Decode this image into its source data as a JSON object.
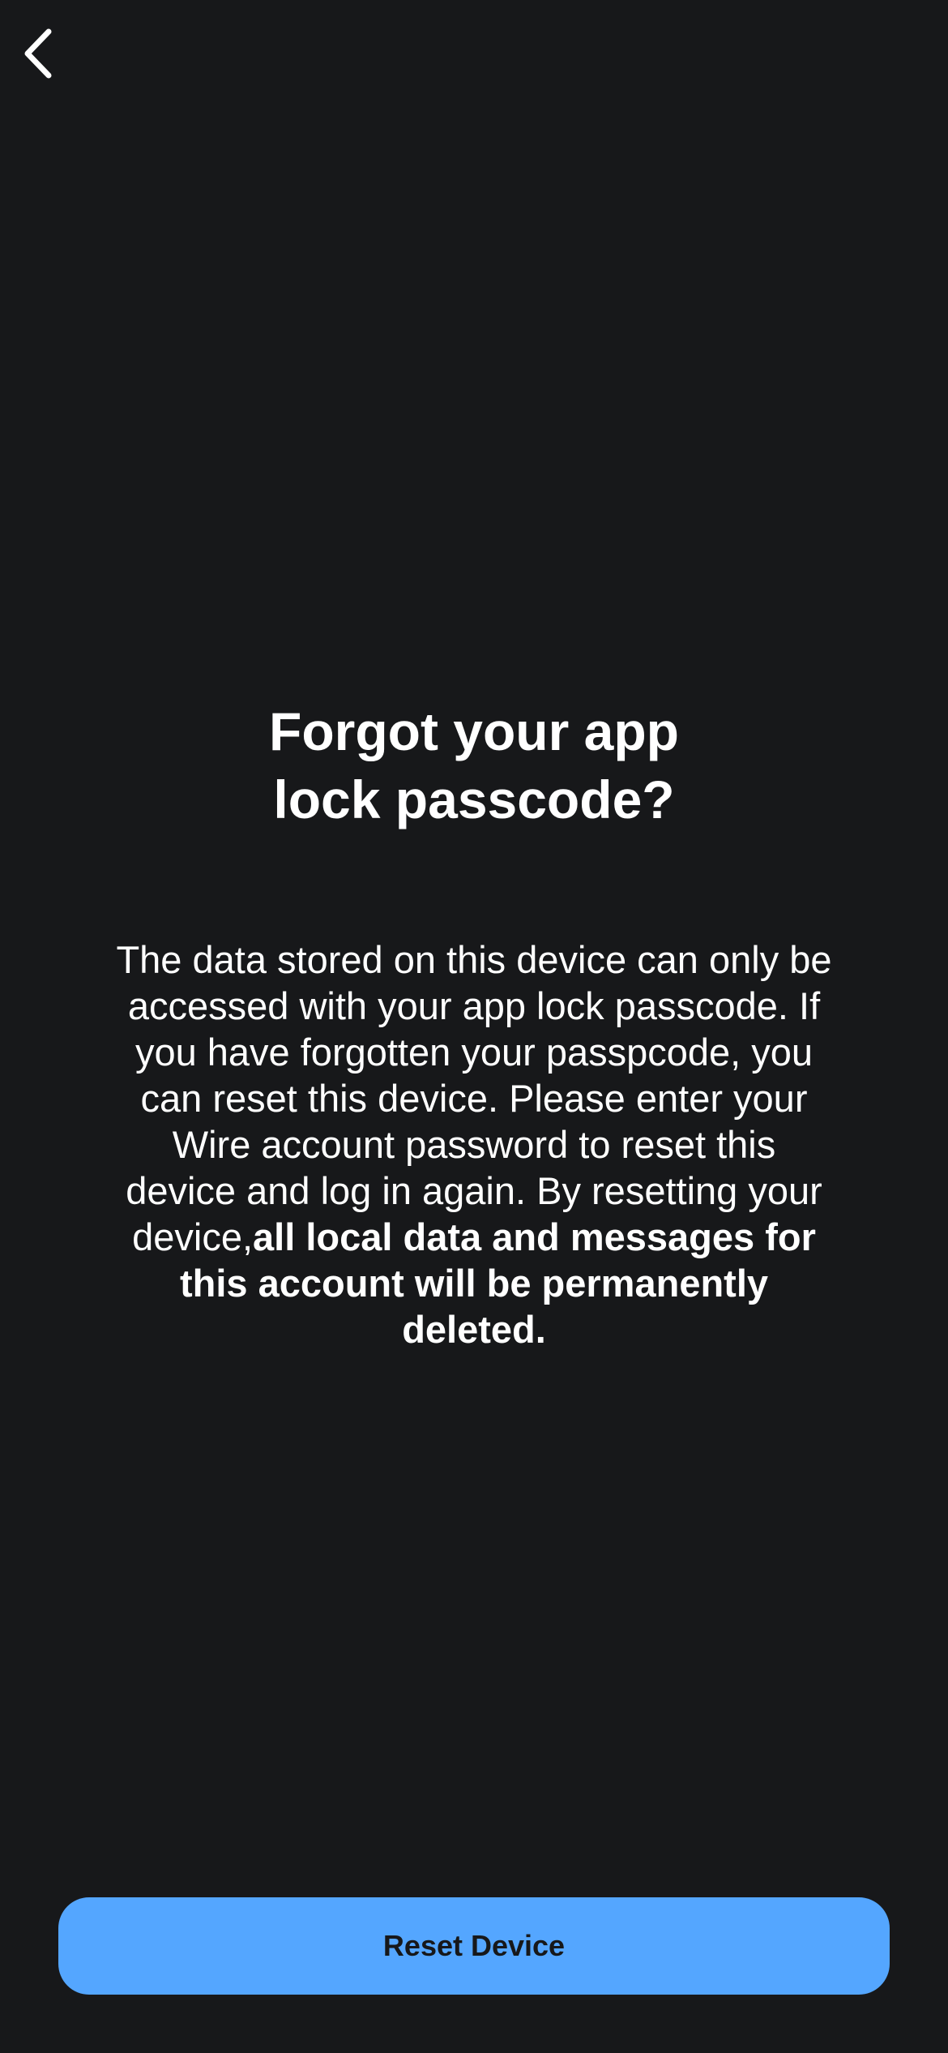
{
  "nav": {
    "back_icon": "chevron-left-icon"
  },
  "content": {
    "title_line1": "Forgot your app",
    "title_line2": "lock passcode?",
    "body_regular": "The data stored on this device can only be accessed with your app lock passcode. If you have forgotten your passpcode, you can reset this device. Please enter your Wire account password to reset this device and log in again. By resetting your device,",
    "body_bold": "all local data and messages for this account will be permanently deleted."
  },
  "actions": {
    "reset_label": "Reset Device"
  },
  "colors": {
    "background": "#17181a",
    "accent": "#54a6ff",
    "text": "#ffffff"
  }
}
